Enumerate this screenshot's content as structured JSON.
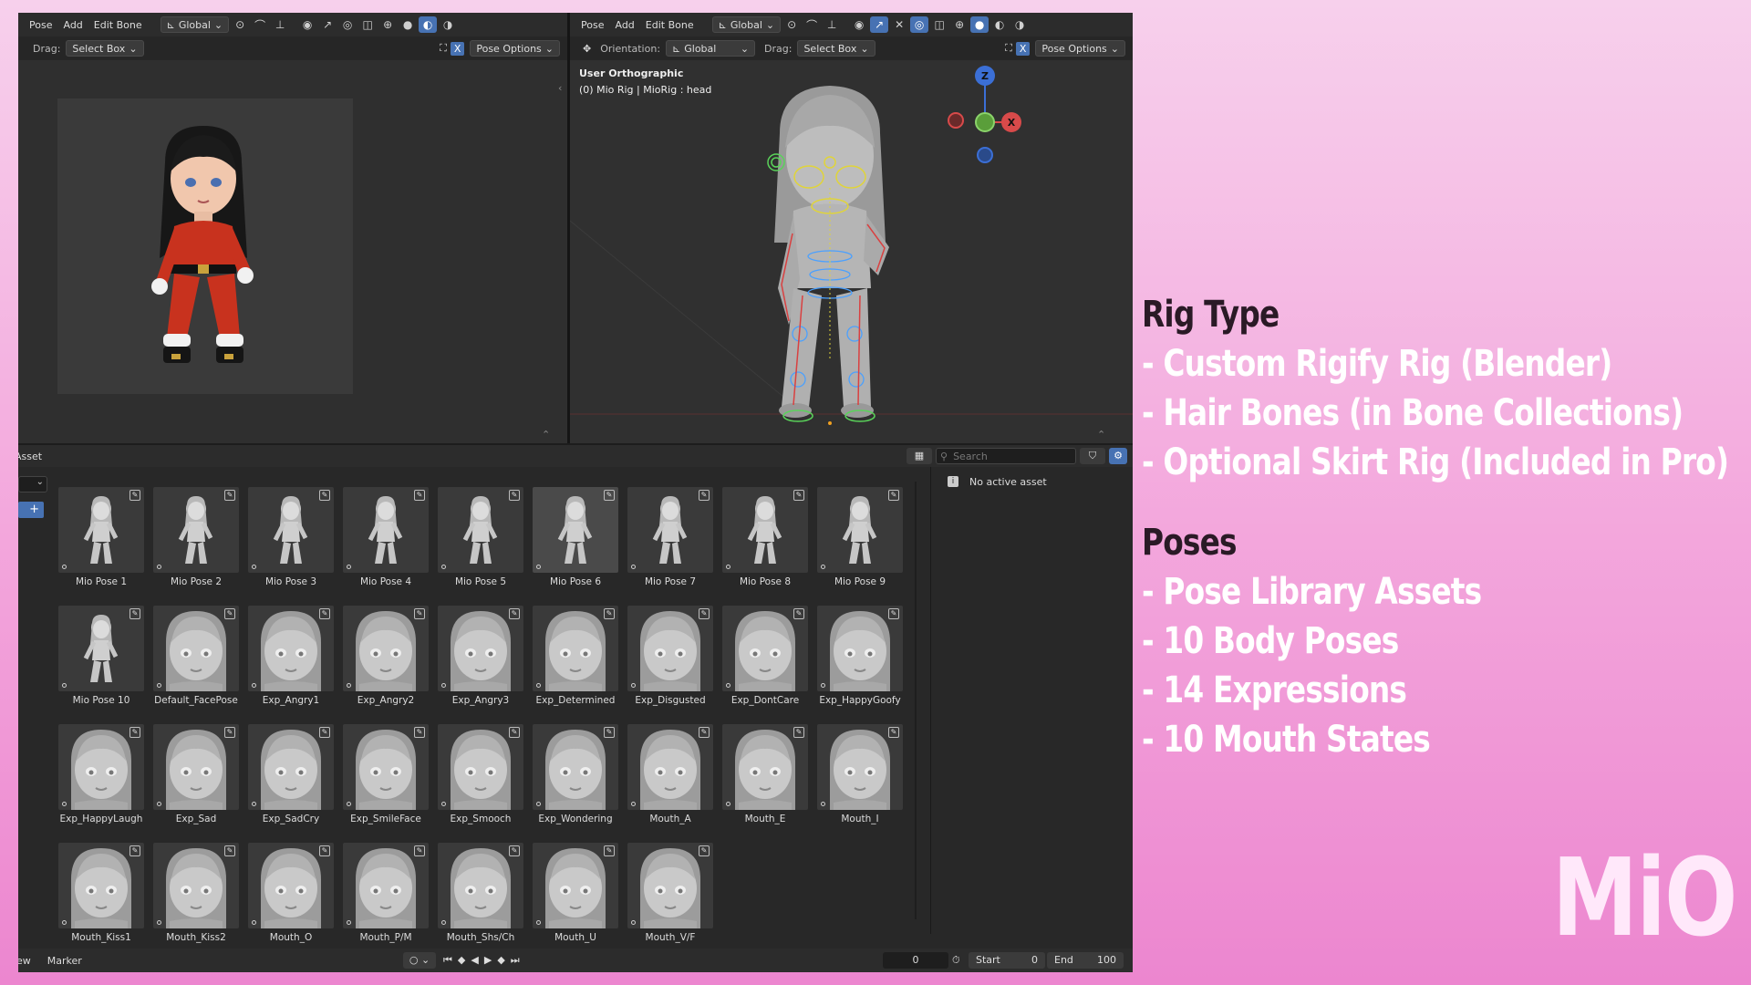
{
  "left_header": {
    "menu": [
      "Pose",
      "Add",
      "Edit Bone"
    ],
    "orientation": "Global"
  },
  "right_header": {
    "menu": [
      "Pose",
      "Add",
      "Edit Bone"
    ],
    "orientation": "Global"
  },
  "left_toolbar": {
    "drag_label": "Drag:",
    "drag_value": "Select Box",
    "pose_options": "Pose Options",
    "x_toggle": "X"
  },
  "right_toolbar": {
    "orientation_label": "Orientation:",
    "orientation_value": "Global",
    "drag_label": "Drag:",
    "drag_value": "Select Box",
    "pose_options": "Pose Options",
    "x_toggle": "X"
  },
  "viewport": {
    "view_name": "User Orthographic",
    "object_info": "(0) Mio Rig | MioRig : head"
  },
  "gizmo": {
    "z": "Z",
    "x": "X"
  },
  "asset_browser": {
    "header_label": "Asset",
    "search_placeholder": "Search",
    "no_active": "No active asset",
    "selected_index": 5,
    "items": [
      {
        "name": "Mio Pose 1",
        "kind": "body"
      },
      {
        "name": "Mio Pose 2",
        "kind": "body"
      },
      {
        "name": "Mio Pose 3",
        "kind": "body"
      },
      {
        "name": "Mio Pose 4",
        "kind": "body"
      },
      {
        "name": "Mio Pose 5",
        "kind": "body"
      },
      {
        "name": "Mio Pose 6",
        "kind": "body"
      },
      {
        "name": "Mio Pose 7",
        "kind": "body"
      },
      {
        "name": "Mio Pose 8",
        "kind": "body"
      },
      {
        "name": "Mio Pose 9",
        "kind": "body"
      },
      {
        "name": "Mio Pose 10",
        "kind": "body"
      },
      {
        "name": "Default_FacePose",
        "kind": "face"
      },
      {
        "name": "Exp_Angry1",
        "kind": "face"
      },
      {
        "name": "Exp_Angry2",
        "kind": "face"
      },
      {
        "name": "Exp_Angry3",
        "kind": "face"
      },
      {
        "name": "Exp_Determined",
        "kind": "face"
      },
      {
        "name": "Exp_Disgusted",
        "kind": "face"
      },
      {
        "name": "Exp_DontCare",
        "kind": "face"
      },
      {
        "name": "Exp_HappyGoofy",
        "kind": "face"
      },
      {
        "name": "Exp_HappyLaugh",
        "kind": "face"
      },
      {
        "name": "Exp_Sad",
        "kind": "face"
      },
      {
        "name": "Exp_SadCry",
        "kind": "face"
      },
      {
        "name": "Exp_SmileFace",
        "kind": "face"
      },
      {
        "name": "Exp_Smooch",
        "kind": "face"
      },
      {
        "name": "Exp_Wondering",
        "kind": "face"
      },
      {
        "name": "Mouth_A",
        "kind": "face"
      },
      {
        "name": "Mouth_E",
        "kind": "face"
      },
      {
        "name": "Mouth_I",
        "kind": "face"
      },
      {
        "name": "Mouth_Kiss1",
        "kind": "face"
      },
      {
        "name": "Mouth_Kiss2",
        "kind": "face"
      },
      {
        "name": "Mouth_O",
        "kind": "face"
      },
      {
        "name": "Mouth_P/M",
        "kind": "face"
      },
      {
        "name": "Mouth_Shs/Ch",
        "kind": "face"
      },
      {
        "name": "Mouth_U",
        "kind": "face"
      },
      {
        "name": "Mouth_V/F",
        "kind": "face"
      }
    ]
  },
  "timeline": {
    "view": "ew",
    "marker": "Marker",
    "frame": "0",
    "start_label": "Start",
    "start": "0",
    "end_label": "End",
    "end": "100"
  },
  "overlay": {
    "rig_heading": "Rig Type",
    "rig_items": [
      "- Custom Rigify Rig (Blender)",
      "- Hair Bones (in Bone Collections)",
      "- Optional Skirt Rig (Included in Pro)"
    ],
    "poses_heading": "Poses",
    "poses_items": [
      "- Pose Library Assets",
      "- 10 Body Poses",
      "- 14 Expressions",
      "- 10 Mouth States"
    ],
    "brand": "MiO"
  },
  "colors": {
    "accent": "#4772b3",
    "outfit": "#c8321e",
    "bg_pink": "#f3a6dc"
  }
}
